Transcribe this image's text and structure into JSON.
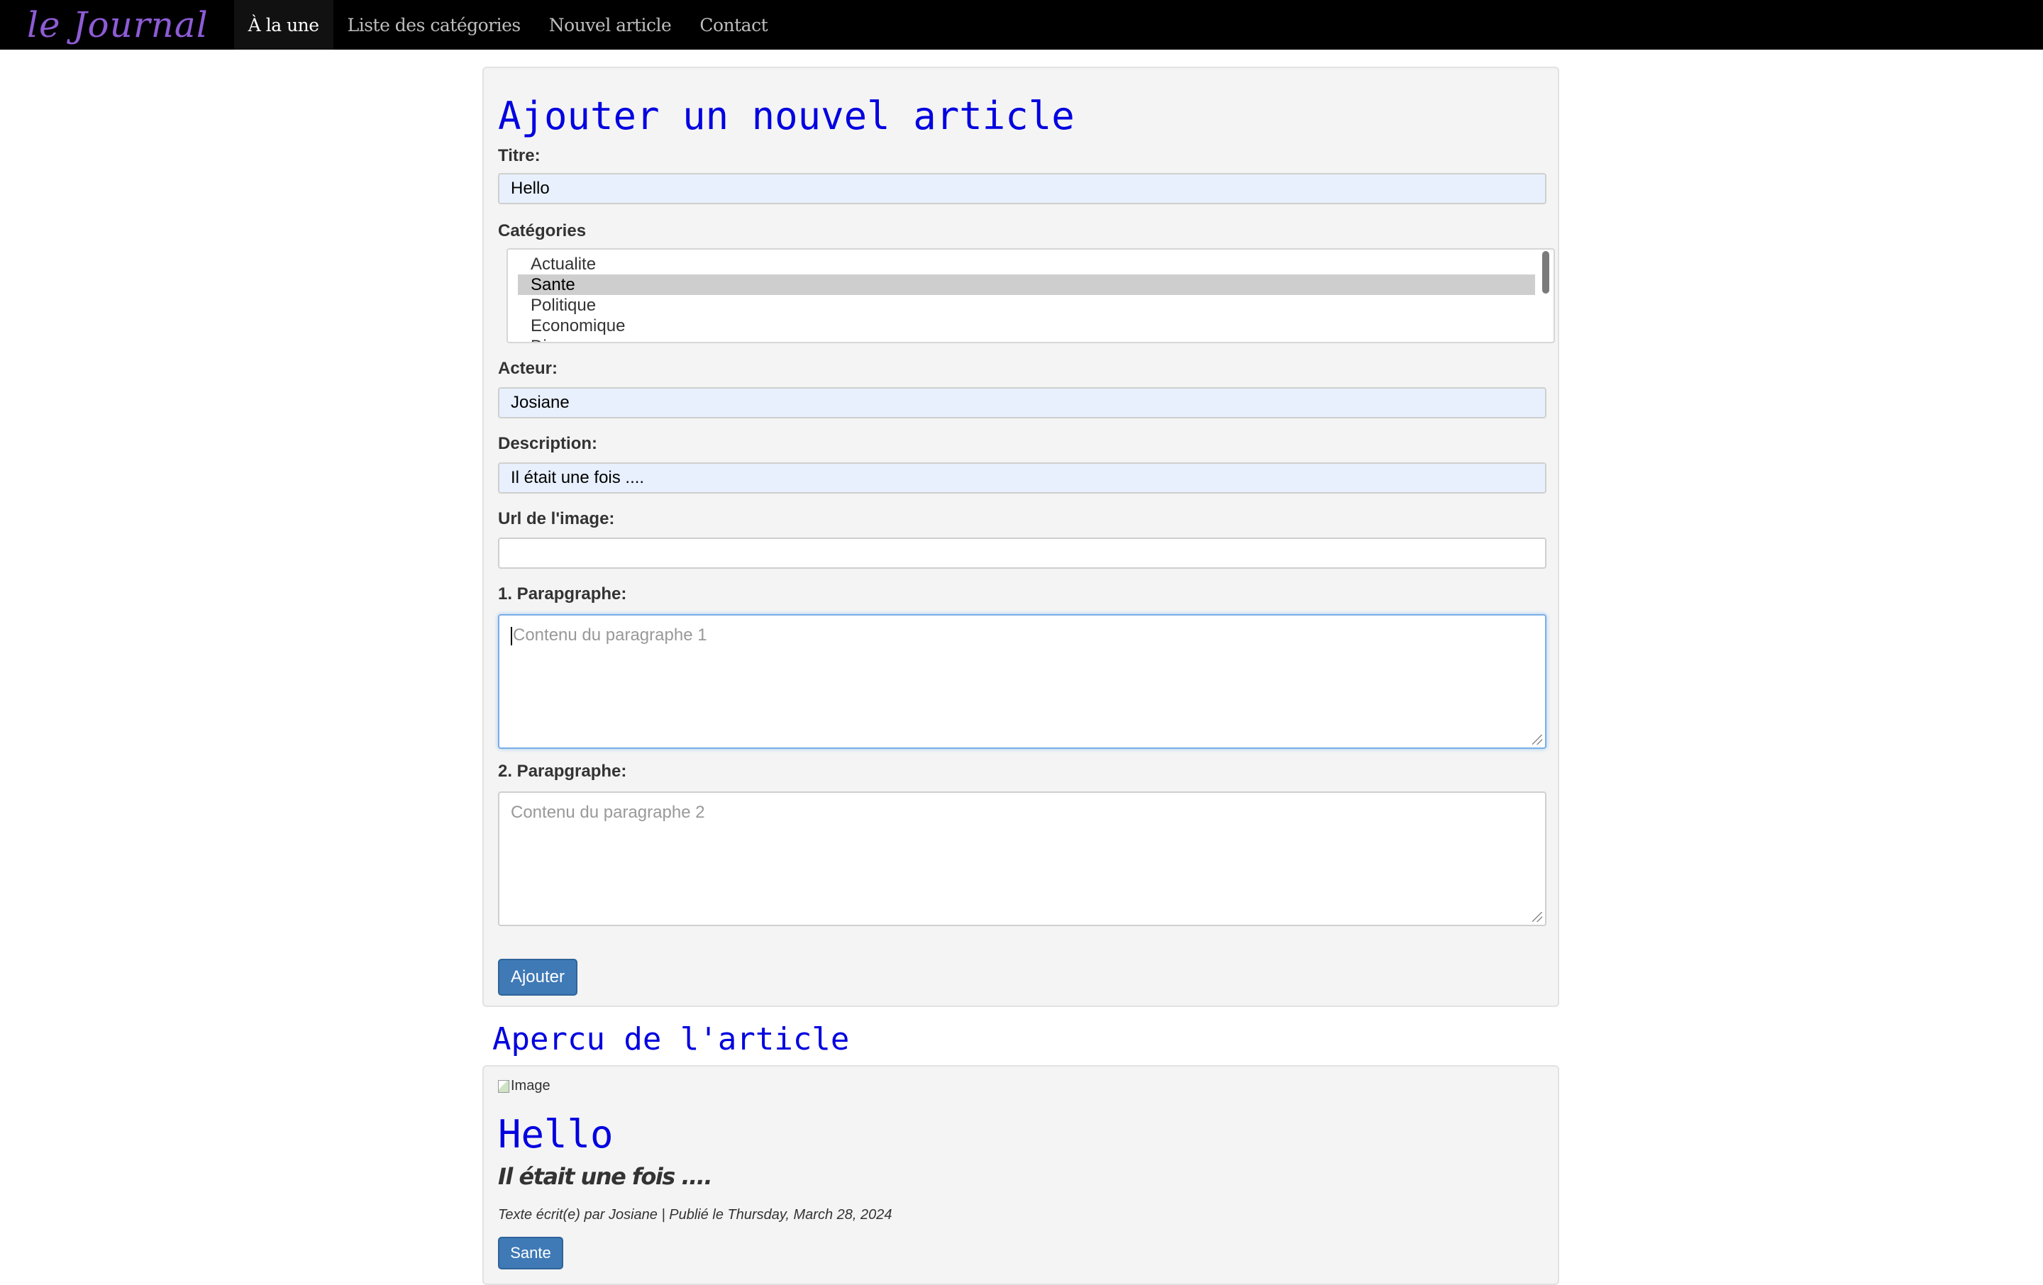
{
  "nav": {
    "brand": "le Journal",
    "items": [
      "À la une",
      "Liste des catégories",
      "Nouvel article",
      "Contact"
    ]
  },
  "form": {
    "heading": "Ajouter un nouvel article",
    "title_label": "Titre:",
    "title_value": "Hello",
    "categories_label": "Catégories",
    "categories": [
      "Actualite",
      "Sante",
      "Politique",
      "Economique",
      "Di..."
    ],
    "selected_category": "Sante",
    "author_label": "Acteur:",
    "author_value": "Josiane",
    "description_label": "Description:",
    "description_value": "Il était une fois ....",
    "image_label": "Url de l'image:",
    "image_value": "",
    "p1_label": "1. Parapgraphe:",
    "p1_placeholder": "Contenu du paragraphe 1",
    "p2_label": "2. Parapgraphe:",
    "p2_placeholder": "Contenu du paragraphe 2",
    "submit_label": "Ajouter"
  },
  "preview": {
    "heading": "Apercu de l'article",
    "image_alt": "Image",
    "title": "Hello",
    "subtitle": "Il était une fois ....",
    "meta": "Texte écrit(e) par Josiane | Publié le Thursday, March 28, 2024",
    "category_badge": "Sante"
  },
  "colors": {
    "heading_blue": "#0000e0",
    "button_blue": "#3f7ab6",
    "brand_purple": "#8e5cd6"
  }
}
